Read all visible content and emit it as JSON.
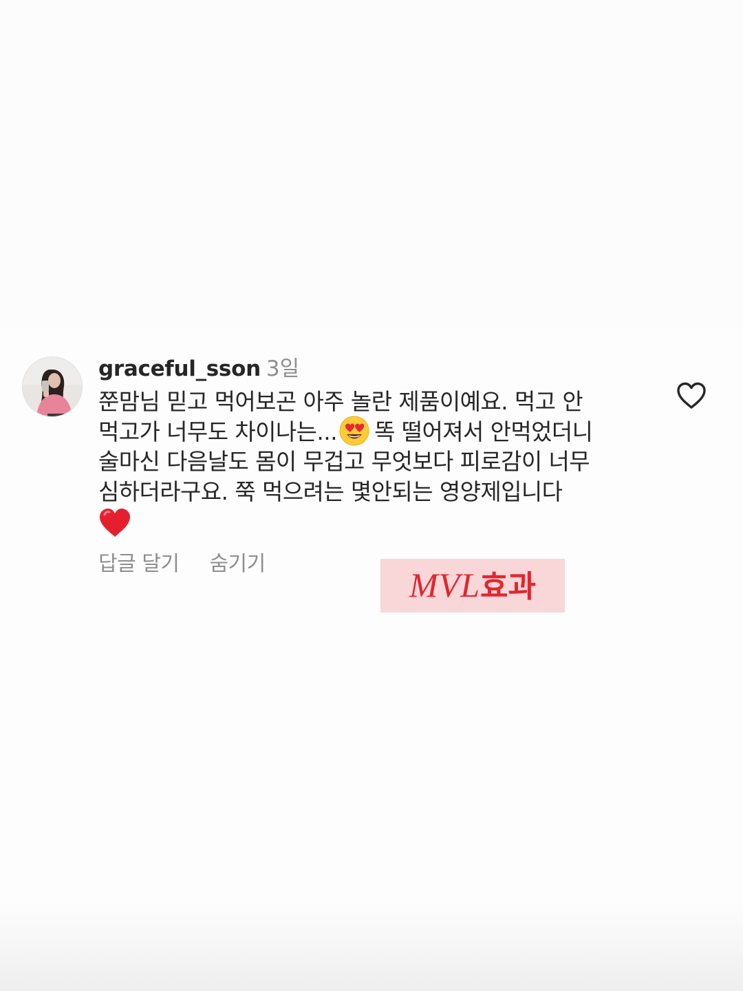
{
  "comment": {
    "username": "graceful_sson",
    "timestamp": "3일",
    "text_lines": [
      "쭌맘님 믿고 먹어보곤 아주 놀란 제품이예요. 먹고 안",
      "먹고가 너무도 차이나는...",
      "똑 떨어져서 안먹었더니",
      "술마신 다음날도 몸이 무겁고 무엇보다 피로감이 너무",
      "심하더라구요. 쭉 먹으려는 몇안되는 영양제입니다"
    ],
    "emojis": [
      "heart-eyes-emoji",
      "red-heart-emoji"
    ],
    "reply_label": "답글 달기",
    "hide_label": "숨기기",
    "like_icon": "heart-outline-icon"
  },
  "watermark": {
    "latin": "MVL",
    "korean": "효과",
    "background": "#f9d7d8",
    "color": "#e3262f"
  },
  "colors": {
    "text_primary": "#262626",
    "text_secondary": "#8e8e8e",
    "background": "#fdfdfd"
  }
}
